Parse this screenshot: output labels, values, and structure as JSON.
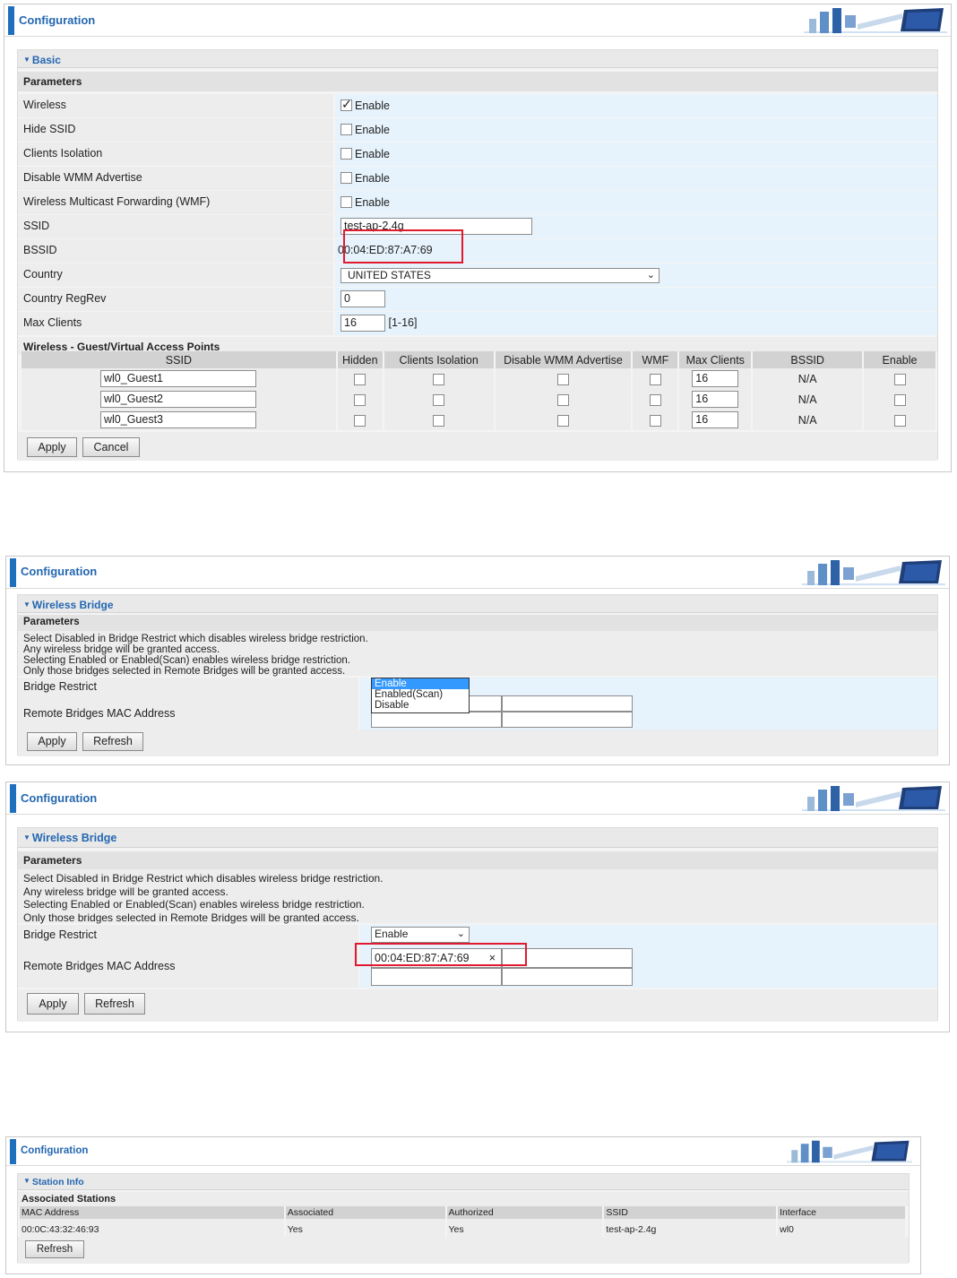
{
  "common": {
    "config_title": "Configuration",
    "apply": "Apply",
    "cancel": "Cancel",
    "refresh": "Refresh",
    "enable": "Enable"
  },
  "basic": {
    "section": "Basic",
    "params_header": "Parameters",
    "rows": {
      "wireless": {
        "label": "Wireless",
        "checked": true
      },
      "hide_ssid": {
        "label": "Hide SSID",
        "checked": false
      },
      "clients_isolation": {
        "label": "Clients Isolation",
        "checked": false
      },
      "disable_wmm": {
        "label": "Disable WMM Advertise",
        "checked": false
      },
      "wmf": {
        "label": "Wireless Multicast Forwarding (WMF)",
        "checked": false
      }
    },
    "ssid_label": "SSID",
    "ssid_value": "test-ap-2.4g",
    "bssid_label": "BSSID",
    "bssid_value": "00:04:ED:87:A7:69",
    "country_label": "Country",
    "country_value": "UNITED STATES",
    "regrev_label": "Country RegRev",
    "regrev_value": "0",
    "maxclients_label": "Max Clients",
    "maxclients_value": "16",
    "maxclients_range": "[1-16]",
    "guest_header": "Wireless - Guest/Virtual Access Points",
    "guest_columns": [
      "SSID",
      "Hidden",
      "Clients Isolation",
      "Disable WMM Advertise",
      "WMF",
      "Max Clients",
      "BSSID",
      "Enable"
    ],
    "guests": [
      {
        "ssid": "wl0_Guest1",
        "max": "16",
        "bssid": "N/A"
      },
      {
        "ssid": "wl0_Guest2",
        "max": "16",
        "bssid": "N/A"
      },
      {
        "ssid": "wl0_Guest3",
        "max": "16",
        "bssid": "N/A"
      }
    ]
  },
  "bridge1": {
    "section": "Wireless Bridge",
    "params_header": "Parameters",
    "desc": [
      "Select Disabled in Bridge Restrict which disables wireless bridge restriction.",
      "Any wireless bridge will be granted access.",
      "Selecting Enabled or Enabled(Scan) enables wireless bridge restriction.",
      "Only those bridges selected in Remote Bridges will be granted access."
    ],
    "restrict_label": "Bridge Restrict",
    "remote_label": "Remote Bridges MAC Address",
    "dropdown_options": [
      "Enable",
      "Enabled(Scan)",
      "Disable"
    ]
  },
  "bridge2": {
    "section": "Wireless Bridge",
    "params_header": "Parameters",
    "restrict_label": "Bridge Restrict",
    "restrict_value": "Enable",
    "remote_label": "Remote Bridges MAC Address",
    "mac_value": "00:04:ED:87:A7:69",
    "clear_glyph": "×"
  },
  "station": {
    "section": "Station Info",
    "header": "Associated Stations",
    "columns": [
      "MAC Address",
      "Associated",
      "Authorized",
      "SSID",
      "Interface"
    ],
    "rows": [
      [
        "00:0C:43:32:46:93",
        "Yes",
        "Yes",
        "test-ap-2.4g",
        "wl0"
      ]
    ]
  },
  "colors": {
    "accent": "#2467b0",
    "highlight": "#e0192f",
    "value_bg": "#e6f3fc"
  }
}
